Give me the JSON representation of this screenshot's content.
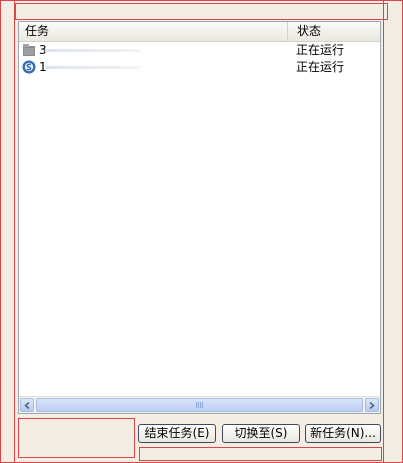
{
  "list": {
    "columns": {
      "task": "任务",
      "status": "状态"
    },
    "rows": [
      {
        "icon": "folder-app-icon",
        "name": "3",
        "status": "正在运行"
      },
      {
        "icon": "blue-circle-app-icon",
        "name": "1",
        "status": "正在运行"
      }
    ]
  },
  "buttons": {
    "end_task": "结束任务(E)",
    "switch_to": "切换至(S)",
    "new_task": "新任务(N)..."
  },
  "icons": {
    "scroll_left": "chevron-left-icon",
    "scroll_right": "chevron-right-icon"
  }
}
